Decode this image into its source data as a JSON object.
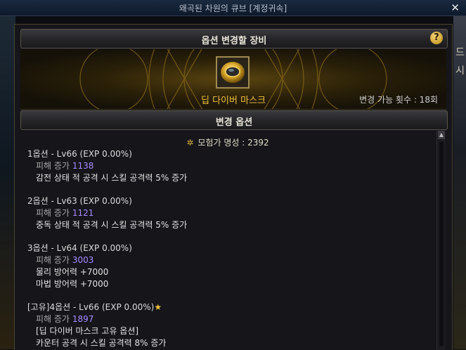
{
  "window": {
    "title": "왜곡된 차원의 큐브 [계정귀속]",
    "close_icon": "✕"
  },
  "background": {
    "right_chars": [
      "드",
      "시"
    ]
  },
  "equip_section": {
    "header": "옵션 변경할 장비",
    "help_icon": "?",
    "item_name": "딥 다이버 마스크",
    "change_count": "변경 가능 횟수 : 18회"
  },
  "options_section": {
    "header": "변경 옵션",
    "fame": "모험가 명성 : 2392",
    "options": [
      {
        "title": "1옵션 - Lv66 (EXP 0.00%)",
        "damage_label": "피해 증가",
        "damage_value": "1138",
        "lines": [
          "감전 상태 적 공격 시 스킬 공격력 5% 증가"
        ]
      },
      {
        "title": "2옵션 - Lv63 (EXP 0.00%)",
        "damage_label": "피해 증가",
        "damage_value": "1121",
        "lines": [
          "중독 상태 적 공격 시 스킬 공격력 5% 증가"
        ]
      },
      {
        "title": "3옵션 - Lv64 (EXP 0.00%)",
        "damage_label": "피해 증가",
        "damage_value": "3003",
        "lines": [
          "물리 방어력 +7000",
          "마법 방어력 +7000"
        ]
      },
      {
        "title": "[고유]4옵션 - Lv66 (EXP 0.00%)",
        "star": "★",
        "damage_label": "피해 증가",
        "damage_value": "1897",
        "lines": [
          "[딥 다이버 마스크 고유 옵션]",
          "카운터 공격 시 스킬 공격력 8% 증가"
        ]
      }
    ]
  },
  "colors": {
    "item_gold": "#f0c23a",
    "value_purple": "#a98bff",
    "frame": "#4a4330"
  }
}
